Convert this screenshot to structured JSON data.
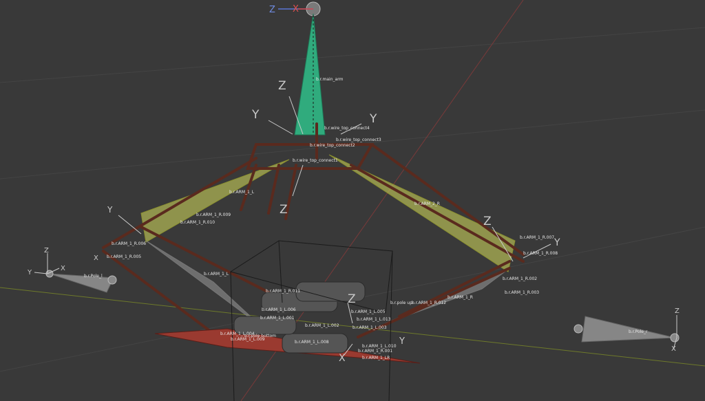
{
  "viewport": {
    "background": "#393939",
    "nav_gizmo": {
      "z_label": "Z",
      "x_label": "X"
    }
  },
  "colors": {
    "main_arm_bone": "#2fbf8a",
    "arm_bones": "#c9d15a",
    "pole_bones": "#9a9a9a",
    "rig_tube": "#5a2a1e",
    "base_plate": "#9a3a30",
    "x_axis_line": "#8a3a3a",
    "y_axis_line": "#6e7a2a",
    "grid_line": "#444444"
  },
  "axis_widgets": {
    "top_left": {
      "z": "Z",
      "y": "Y"
    },
    "top_right": {
      "y": "Y"
    },
    "top_center": {
      "z": "Z"
    },
    "under_center": {
      "z": "Z"
    },
    "left_arm": {
      "y": "Y",
      "x": "X"
    },
    "right_arm": {
      "z": "Z",
      "y": "Y"
    },
    "pole_left": {
      "z": "Z",
      "y": "Y",
      "x": "X"
    },
    "pole_right": {
      "z": "Z",
      "x": "X"
    },
    "bottom": {
      "z": "Z",
      "x": "X",
      "y": "Y"
    }
  },
  "bone_labels": {
    "main_arm": "b.r.main_arm",
    "wire_top_connect4": "b.r.wire_top_connect4",
    "wire_top_connect3": "b.r.wire_top_connect3",
    "wire_top_connect2": "b.r.wire_top_connect2",
    "wire_top_connect1": "b.r.wire_top_connect1",
    "arm_1_l": "b.r.ARM_1_L",
    "arm_2_r": "b.r.ARM_2_R",
    "arm_1_r_009": "b.r.ARM_1_R.009",
    "arm_1_r_010": "b.r.ARM_1_R.010",
    "arm_1_r_006": "b.r.ARM_1_R.006",
    "arm_1_r_005": "b.r.ARM_1_R.005",
    "arm_1_r_007": "b.r.ARM_1_R.007",
    "arm_1_r_008": "b.r.ARM_1_R.008",
    "arm_1_r_002": "b.r.ARM_1_R.002",
    "arm_1_r_003": "b.r.ARM_1_R.003",
    "arm_1_r": "b.r.ARM_1_R",
    "arm_1_r_011": "b.r.ARM_1_R.011",
    "arm_1_l_plain": "b.r.ARM_1_L",
    "pole_l": "b.r.Pole_l",
    "pole_r": "b.r.Pole_r",
    "pole_up": "b.r.pole up",
    "arm_1_r_012": "b.r.ARM_1_R.012",
    "arm_1_l_006": "b.r.ARM_1_L.006",
    "arm_1_l_001": "b.r.ARM_1_L.001",
    "arm_1_l_002": "b.r.ARM_1_L.002",
    "arm_1_l_003": "b.r.ARM_1_L.003",
    "arm_1_l_005": "b.r.ARM_1_L.005",
    "arm_1_l_013": "b.r.ARM_1_L.013",
    "arm_1_l_004": "b.r.ARM_1_L.004",
    "arm_1_l_009": "b.r.ARM_1_L.009",
    "pole_bottom": "b.r.pole bottom",
    "arm_1_l_008": "b.r.ARM_1_L.008",
    "arm_1_l_010": "b.r.ARM_1_L.010",
    "arm_1_r_001": "b.r.ARM_1_R.001",
    "arm_1_lr": "b.r.ARM_1_LR"
  }
}
